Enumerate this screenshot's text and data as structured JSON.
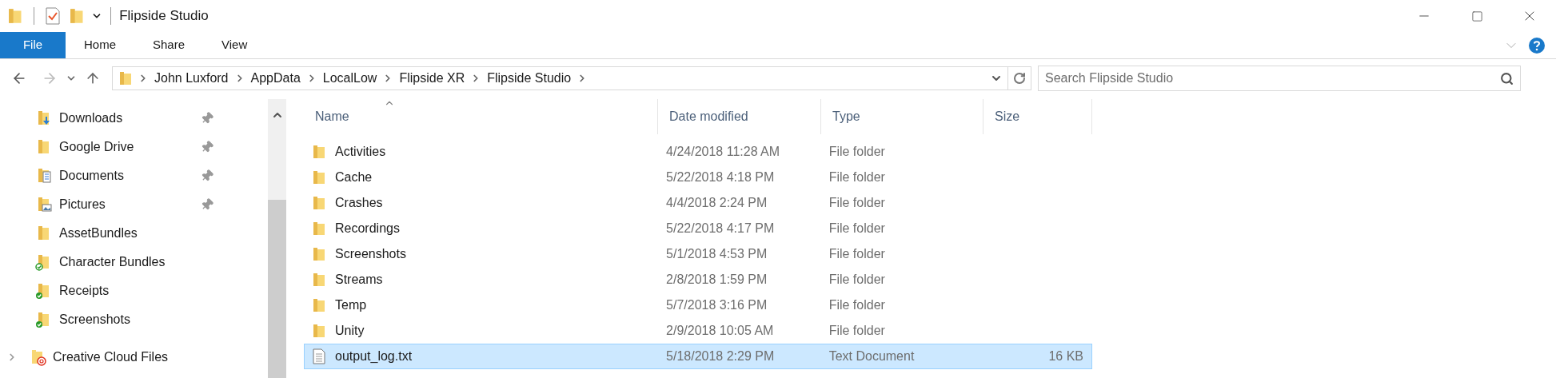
{
  "window": {
    "title": "Flipside Studio"
  },
  "ribbon": {
    "tabs": [
      {
        "label": "File",
        "kind": "file_menu"
      },
      {
        "label": "Home",
        "kind": "tab"
      },
      {
        "label": "Share",
        "kind": "tab"
      },
      {
        "label": "View",
        "kind": "tab"
      }
    ]
  },
  "address_bar": {
    "breadcrumbs": [
      "John Luxford",
      "AppData",
      "LocalLow",
      "Flipside XR",
      "Flipside Studio"
    ]
  },
  "search": {
    "placeholder": "Search Flipside Studio"
  },
  "sidebar": {
    "items": [
      {
        "label": "Downloads",
        "kind": "downloads",
        "pinned": true
      },
      {
        "label": "Google Drive",
        "kind": "folder",
        "pinned": true
      },
      {
        "label": "Documents",
        "kind": "documents",
        "pinned": true
      },
      {
        "label": "Pictures",
        "kind": "pictures",
        "pinned": true
      },
      {
        "label": "AssetBundles",
        "kind": "folder",
        "pinned": false
      },
      {
        "label": "Character Bundles",
        "kind": "synced_outline",
        "pinned": false
      },
      {
        "label": "Receipts",
        "kind": "synced",
        "pinned": false
      },
      {
        "label": "Screenshots",
        "kind": "synced",
        "pinned": false
      }
    ],
    "roots": [
      {
        "label": "Creative Cloud Files",
        "expanded": false
      }
    ]
  },
  "file_list": {
    "columns": [
      {
        "label": "Name",
        "sorted": true
      },
      {
        "label": "Date modified",
        "sorted": false
      },
      {
        "label": "Type",
        "sorted": false
      },
      {
        "label": "Size",
        "sorted": false
      }
    ],
    "rows": [
      {
        "name": "Activities",
        "date_modified": "4/24/2018 11:28 AM",
        "type": "File folder",
        "kind": "folder",
        "selected": false
      },
      {
        "name": "Cache",
        "date_modified": "5/22/2018 4:18 PM",
        "type": "File folder",
        "kind": "folder",
        "selected": false
      },
      {
        "name": "Crashes",
        "date_modified": "4/4/2018 2:24 PM",
        "type": "File folder",
        "kind": "folder",
        "selected": false
      },
      {
        "name": "Recordings",
        "date_modified": "5/22/2018 4:17 PM",
        "type": "File folder",
        "kind": "folder",
        "selected": false
      },
      {
        "name": "Screenshots",
        "date_modified": "5/1/2018 4:53 PM",
        "type": "File folder",
        "kind": "folder",
        "selected": false
      },
      {
        "name": "Streams",
        "date_modified": "2/8/2018 1:59 PM",
        "type": "File folder",
        "kind": "folder",
        "selected": false
      },
      {
        "name": "Temp",
        "date_modified": "5/7/2018 3:16 PM",
        "type": "File folder",
        "kind": "folder",
        "selected": false
      },
      {
        "name": "Unity",
        "date_modified": "2/9/2018 10:05 AM",
        "type": "File folder",
        "kind": "folder",
        "selected": false
      },
      {
        "name": "output_log.txt",
        "date_modified": "5/18/2018 2:29 PM",
        "type": "Text Document",
        "size": "16 KB",
        "kind": "text",
        "selected": true
      }
    ]
  }
}
